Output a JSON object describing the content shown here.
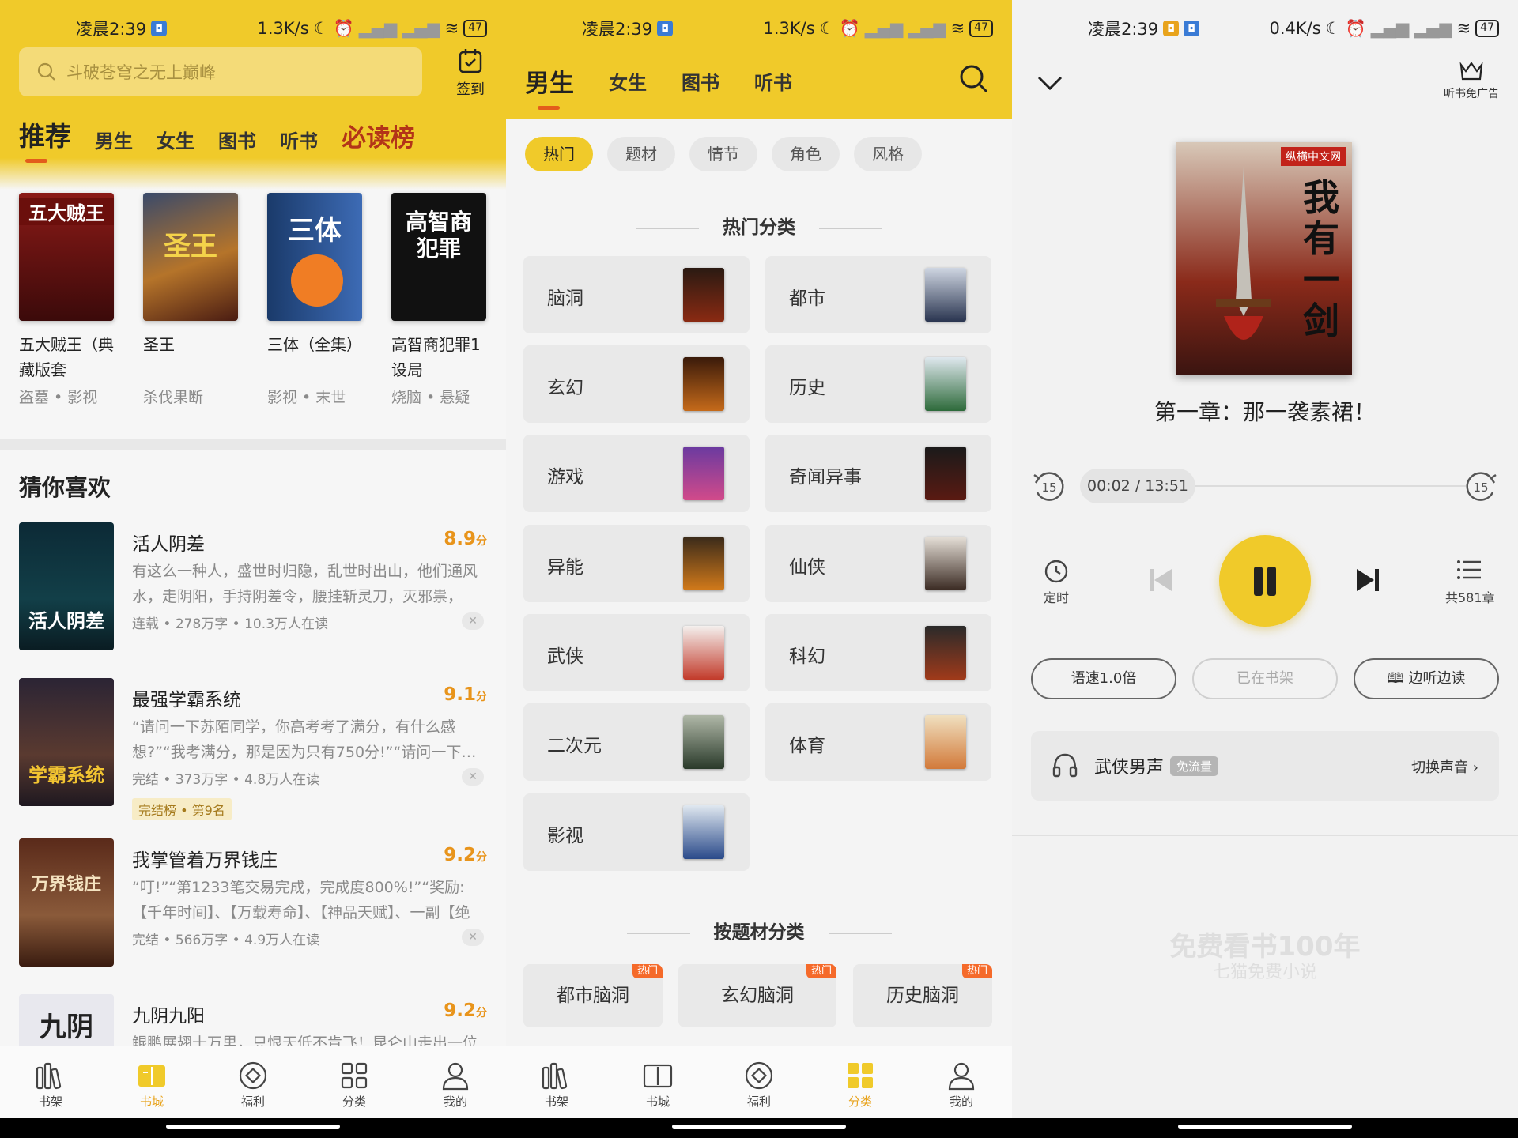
{
  "status_bars": [
    {
      "time": "凌晨2:39",
      "speed": "1.3K/s",
      "battery": "47"
    },
    {
      "time": "凌晨2:39",
      "speed": "1.3K/s",
      "battery": "47"
    },
    {
      "time": "凌晨2:39",
      "speed": "0.4K/s",
      "battery": "47"
    }
  ],
  "bookstore": {
    "search_placeholder": "斗破苍穹之无上巅峰",
    "signin_label": "签到",
    "tabs": [
      "推荐",
      "男生",
      "女生",
      "图书",
      "听书",
      "必读榜"
    ],
    "featured": [
      {
        "cover_text": "五大贼王",
        "title": "五大贼王（典藏版套",
        "meta": "盗墓 • 影视"
      },
      {
        "cover_text": "圣王",
        "title": "圣王",
        "meta": "杀伐果断"
      },
      {
        "cover_text": "三体",
        "title": "三体（全集）",
        "meta": "影视 • 末世"
      },
      {
        "cover_text": "高智商犯罪",
        "title": "高智商犯罪1设局",
        "meta": "烧脑 • 悬疑"
      }
    ],
    "section_title": "猜你喜欢",
    "list": [
      {
        "title": "活人阴差",
        "score": "8.9",
        "unit": "分",
        "desc": "有这么一种人，盛世时归隐，乱世时出山，他们通风水，走阴阳，手持阴差令，腰挂斩灵刀，灭邪祟，度…",
        "meta": "连载 • 278万字 • 10.3万人在读",
        "close": "✕",
        "cover_text": "活人阴差"
      },
      {
        "title": "最强学霸系统",
        "score": "9.1",
        "unit": "分",
        "desc": "“请问一下苏陌同学，你高考考了满分，有什么感想?”“我考满分，那是因为只有750分!”“请问一下…",
        "meta": "完结 • 373万字 • 4.8万人在读",
        "close": "✕",
        "tag": "完结榜 • 第9名",
        "cover_text": "学霸系统"
      },
      {
        "title": "我掌管着万界钱庄",
        "score": "9.2",
        "unit": "分",
        "desc": "“叮!”“第1233笔交易完成，完成度800%!”“奖励:【千年时间】、【万载寿命】、【神品天赋】、一副【绝世…",
        "meta": "完结 • 566万字 • 4.9万人在读",
        "close": "✕",
        "cover_text": "万界钱庄"
      },
      {
        "title": "九阴九阳",
        "score": "9.2",
        "unit": "分",
        "desc": "鲲鹏展翅十万里，只恨天低不肯飞！昆仑山走出一位",
        "cover_text": "九阴"
      }
    ]
  },
  "category_page": {
    "tabs": [
      "男生",
      "女生",
      "图书",
      "听书"
    ],
    "chips": [
      "热门",
      "题材",
      "情节",
      "角色",
      "风格"
    ],
    "hot_title": "热门分类",
    "categories": [
      "脑洞",
      "都市",
      "玄幻",
      "历史",
      "游戏",
      "奇闻异事",
      "异能",
      "仙侠",
      "武侠",
      "科幻",
      "二次元",
      "体育",
      "影视"
    ],
    "theme_title": "按题材分类",
    "themes": [
      {
        "label": "都市脑洞",
        "badge": "热门"
      },
      {
        "label": "玄幻脑洞",
        "badge": "热门"
      },
      {
        "label": "历史脑洞",
        "badge": "热门"
      }
    ]
  },
  "nav": [
    "书架",
    "书城",
    "福利",
    "分类",
    "我的"
  ],
  "player": {
    "ad_free": "听书免广告",
    "chapter": "第一章：那一袭素裙！",
    "progress_text": "00:02 / 13:51",
    "progress_fraction": 0.0024,
    "skip": "15",
    "timer": "定时",
    "chapters": "共581章",
    "speed": "语速1.0倍",
    "on_shelf": "已在书架",
    "read_along": "边听边读",
    "voice_name": "武侠男声",
    "voice_tag": "免流量",
    "switch_voice": "切换声音",
    "cover_title": "我有一剑",
    "cover_publisher": "纵横中文网",
    "watermark_1": "免费看书100年",
    "watermark_2": "七猫免费小说"
  },
  "colors": {
    "accent": "#f0ca2a",
    "score": "#e8941b",
    "hot": "#b33418"
  }
}
